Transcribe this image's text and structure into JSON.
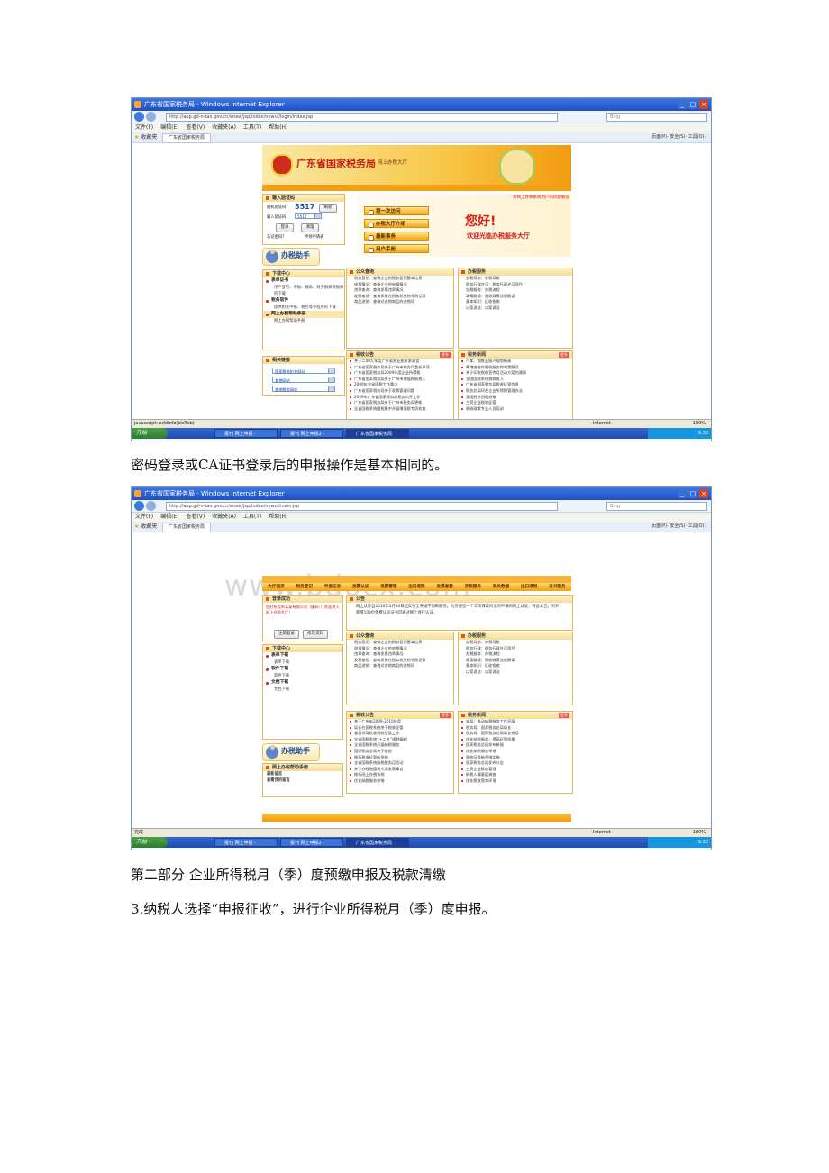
{
  "browser": {
    "window_title_1": "广东省国家税务局 - Windows Internet Explorer",
    "url_1": "http://app.gd-n-tax.gov.cn/wssw/jsp/index/newui/login/index.jsp",
    "search_placeholder": "Bing",
    "menu_items": [
      "文件(F)",
      "编辑(E)",
      "查看(V)",
      "收藏夹(A)",
      "工具(T)",
      "帮助(H)"
    ],
    "favorites_label": "收藏夹",
    "tab_label": "广东省国家税务局",
    "toolbar_right": "页面(P)· 安全(S)· 工具(O)·",
    "status_text_1": "javascript: addInfo(clsReb)",
    "internet_label": "Internet",
    "zoom_label": "100%",
    "clock": "9:30",
    "start_label": "开始",
    "task_1": "报刊 网上申报 -",
    "task_2": "报刊 网上申报2 -",
    "task_3": "广东省国家税务局",
    "window_title_2": "广东省国家税务局 - Windows Internet Explorer",
    "url_2": "http://app.gd-n-tax.gov.cn/wssw/jsp/index/newui/main.jsp",
    "status_text_2": "完成"
  },
  "shot1": {
    "header_title": "广东省国家税务局",
    "header_sub": "网上办税大厅",
    "banner_notice": "通过如下网址可直接访问网上办税服务大厅  http://app.gd-n-tax.gov.cn",
    "login_title": "输入验证码",
    "login_code_label": "随机验证码：",
    "login_code_value": "5517",
    "login_refresh": "刷新",
    "login_input_label": "输入验证码：",
    "login_input_value": "5517",
    "login_btn": "登录",
    "clear_btn": "清理",
    "forgot_pwd": "忘记密码？",
    "apply_form": "申领申请表",
    "help_title": "办税助手",
    "notice_link": "对网上办税系统用户的问题解答",
    "nav_items": [
      "第一次访问",
      "办税大厅介绍",
      "最新事务",
      "用户手册"
    ],
    "welcome_big": "您好!",
    "welcome_sub": "欢迎光临办税服务大厅",
    "download_title": "下载中心",
    "download_sections": [
      {
        "title": "表单证书",
        "text": "用户登记、申报、报表、财务报表等报表的下载"
      },
      {
        "title": "税务软件",
        "text": "提供相关申报、税控等小程序的下载"
      },
      {
        "title": "网上办税帮助手册",
        "text": "网上办税帮助手册"
      }
    ],
    "links_title": "相关链接",
    "links": [
      "国家税务机关网站",
      "其他网站",
      "其他税务网站"
    ],
    "query_title": "公众查询",
    "query_items": [
      "税务登记：查询企业的税务登记基本信息",
      "申报情况：查询企业的申报情况",
      "违章查询：查询发票违章情况",
      "发票查验：查询发票在税务机关的领购记录",
      "商品进销：查询对进销商品的进销项"
    ],
    "service_title": "办税服务",
    "service_items": [
      "办税导航：办税导航",
      "税务行政许可：税务行政许可项目",
      "办税服务：办税流程",
      "政策解读：税收政策法规解读",
      "基本知识：征收指南",
      "以案说法：以案说法"
    ],
    "news_title": "税收公告",
    "news_more": "更多",
    "news_items": [
      "关于二00九年度广东省营业税发票事宜",
      "广东省国家税务局关于广州市税务局委托事项",
      "广东省国家税务局2009年度企业所得税",
      "广东省国家税务局关于广州市增值税纳税人",
      "2009年全省国税工作重点",
      "广东省国家税务局关于发票管理问题",
      "2009年广东省国家税务局税务公开工作",
      "广东省国家税务局关于广州市税务局更新",
      "全省国税系统国税集中开展增值税专项检查"
    ],
    "tax_news_title": "税务新闻",
    "tax_news_items": [
      "汽车、钢铁业振兴规划新闻",
      "粤港澳合作税收服务和政策解读",
      "关于印发税收宣传月活动方案的通知",
      "全国国税系统税收收入",
      "广东省国家税务局税收征管信息",
      "税务总局印发企业所得税管理办法",
      "我国经济回暖迹象",
      "三资企业税收征管",
      "税收政策专业人员培训"
    ]
  },
  "between": "密码登录或CA证书登录后的申报操作是基本相同的。",
  "shot2": {
    "watermark": "www.bdocx.com",
    "banner_notice": "通过如下网址可直接访问网上办税服务大厅  http://app.gd-n-tax.gov.cn",
    "nav": [
      "大厅首页",
      "税务登记",
      "申报征收",
      "发票认证",
      "发票管理",
      "出口退税",
      "发票查验",
      "涉税服务",
      "海关数据",
      "出口退税",
      "证书服务"
    ],
    "login_title": "登录成功",
    "login_msg": "您好东莞市某某有限公司（编码：）欢迎进入网上办税大厅！",
    "exit_btn": "注销登录",
    "modify_btn": "修改资料",
    "notice_title": "公告",
    "notice_text": "网上认证自2010年4月30日起实行全天候不间断服务。为方便您一个工作日及时准时申报同网上认证，特此公告。另外，新增108位免费认证证书可通过网上进行认证。",
    "download_title": "下载中心",
    "download_items": [
      "表单下载",
      "表单下载",
      "软件下载",
      "软件下载",
      "文档下载",
      "文档下载"
    ],
    "help_title": "办税助手",
    "help_links_title": "网上办税帮助手册",
    "help_links": [
      "最新留言",
      "查看我的留言"
    ],
    "query_title": "公众查询",
    "query_items": [
      "税务登记：查询企业的税务登记基本信息",
      "申报情况：查询企业的申报情况",
      "违章查询：查询发票违章情况",
      "发票查验：查询发票在税务机关的领购记录",
      "商品进销：查询对进销商品的进销项"
    ],
    "service_title": "办税服务",
    "service_items": [
      "办税导航：办税导航",
      "税务行政：税务行政许可项目",
      "办税服务：办税流程",
      "政策解读：税收政策法规解读",
      "基本知识：征收指南",
      "以案说法：以案说法"
    ],
    "news_title": "税收公告",
    "news_more": "更多",
    "news_items": [
      "关于广东省2009-2010年度",
      "局长在国税系统关于税收征管",
      "省局领导检查税收征管工作",
      "全省国税系统“十二五”规划编制",
      "全省国税系统开展纳税服务",
      "国家税务总局关于推进",
      "推行税收征管新举措",
      "全省国税系统纳税服务月活动",
      "关于办理增值税专用发票事宜",
      "推行网上办税系统",
      "优化纳税服务举措"
    ],
    "tax_news_title": "税务新闻",
    "tax_news_items": [
      "省局：推动纳税服务工作开展",
      "税务局：国家税务总局局长",
      "税务局：国家税务总局局长讲话",
      "优化纳税服务，提高征管质量",
      "国家税务总局发布新规",
      "优化纳税服务举措",
      "税收征管新举措实施",
      "国家税务总局发布公告",
      "三资企业税收管理",
      "纳税人满意度调查",
      "优化税收营商环境"
    ]
  },
  "heading": "第二部分 企业所得税月（季）度预缴申报及税款清缴",
  "step": "3.纳税人选择“申报征收”，进行企业所得税月（季）度申报。"
}
